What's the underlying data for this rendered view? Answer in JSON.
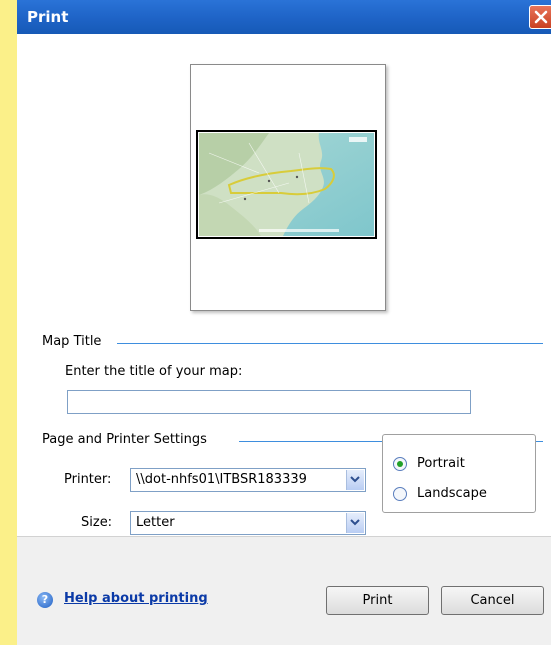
{
  "window": {
    "title": "Print"
  },
  "map_title_section": {
    "legend": "Map Title",
    "prompt": "Enter the title of your map:",
    "title_value": ""
  },
  "settings_section": {
    "legend": "Page and Printer Settings",
    "printer_label": "Printer:",
    "printer_value": "\\\\dot-nhfs01\\ITBSR183339",
    "size_label": "Size:",
    "size_value": "Letter"
  },
  "orientation": {
    "options": [
      "Portrait",
      "Landscape"
    ],
    "selected": "Portrait"
  },
  "footer": {
    "help_label": "Help about printing",
    "print_label": "Print",
    "cancel_label": "Cancel"
  },
  "colors": {
    "titlebar": "#1e63c6",
    "accent_line": "#3e8ede",
    "link": "#0b3aa7",
    "radio_selected": "#22a028"
  },
  "icons": {
    "close": "close-icon",
    "help": "help-icon",
    "dropdown": "chevron-down-icon"
  }
}
